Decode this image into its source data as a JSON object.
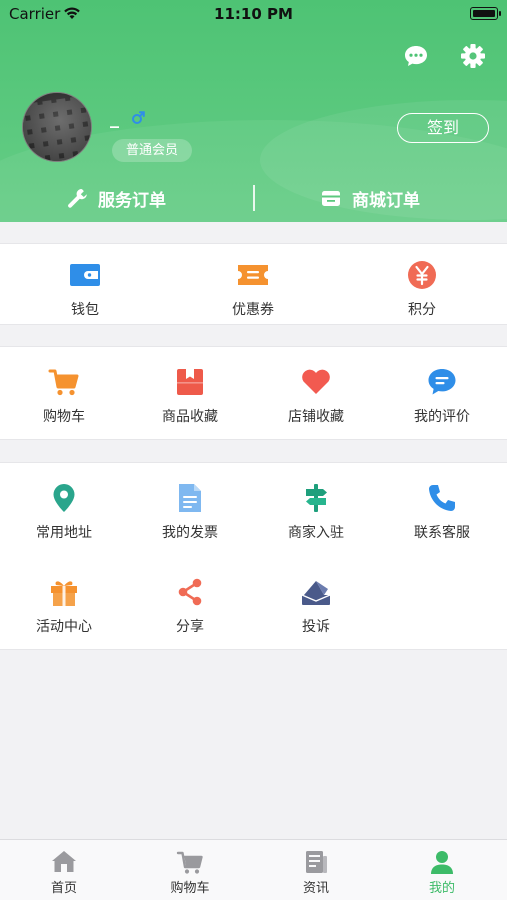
{
  "status_bar": {
    "carrier": "Carrier",
    "time": "11:10 PM"
  },
  "profile": {
    "username": "_",
    "member_level": "普通会员",
    "signin_label": "签到"
  },
  "orders": {
    "service_label": "服务订单",
    "mall_label": "商城订单"
  },
  "assets": [
    {
      "label": "钱包",
      "icon": "wallet-icon"
    },
    {
      "label": "优惠券",
      "icon": "coupon-icon"
    },
    {
      "label": "积分",
      "icon": "points-icon"
    }
  ],
  "collections": [
    {
      "label": "购物车",
      "icon": "cart-icon"
    },
    {
      "label": "商品收藏",
      "icon": "goods-favorite-icon"
    },
    {
      "label": "店铺收藏",
      "icon": "heart-icon"
    },
    {
      "label": "我的评价",
      "icon": "comment-icon"
    }
  ],
  "services": [
    {
      "label": "常用地址",
      "icon": "location-icon"
    },
    {
      "label": "我的发票",
      "icon": "invoice-icon"
    },
    {
      "label": "商家入驻",
      "icon": "signpost-icon"
    },
    {
      "label": "联系客服",
      "icon": "phone-icon"
    },
    {
      "label": "活动中心",
      "icon": "gift-icon"
    },
    {
      "label": "分享",
      "icon": "share-icon"
    },
    {
      "label": "投诉",
      "icon": "complaint-icon"
    }
  ],
  "tabbar": [
    {
      "label": "首页",
      "icon": "home-icon"
    },
    {
      "label": "购物车",
      "icon": "cart-icon"
    },
    {
      "label": "资讯",
      "icon": "news-icon"
    },
    {
      "label": "我的",
      "icon": "user-icon",
      "active": true
    }
  ],
  "colors": {
    "header_green": "#4ec374",
    "active_tab": "#3dbb68",
    "wallet_blue": "#2f8ee8",
    "coupon_orange": "#f5922f",
    "points_red": "#f06b55"
  }
}
